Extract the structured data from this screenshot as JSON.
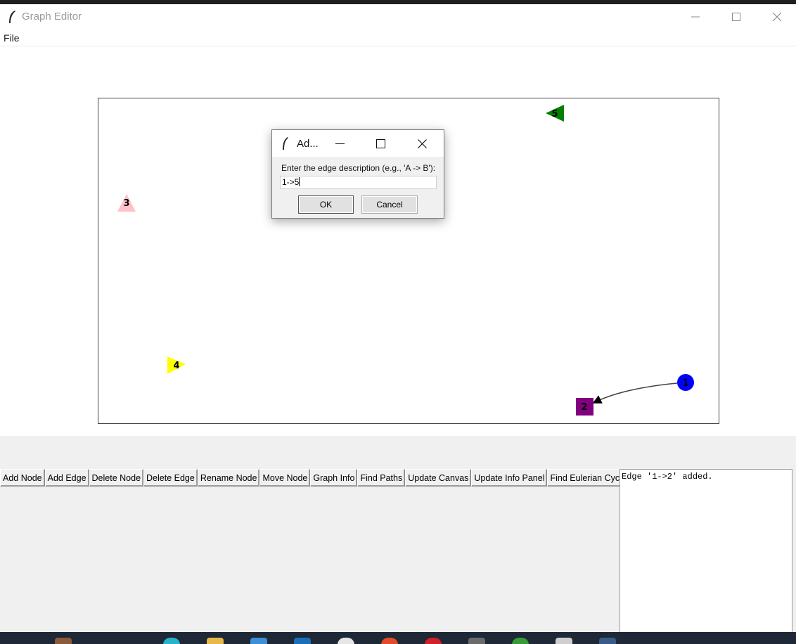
{
  "window": {
    "title": "Graph Editor"
  },
  "menu": {
    "file": "File"
  },
  "graph": {
    "nodes": [
      {
        "label": "1",
        "shape": "circle",
        "color": "#0000ff"
      },
      {
        "label": "2",
        "shape": "square",
        "color": "#800080"
      },
      {
        "label": "3",
        "shape": "triangle-up",
        "color": "#ffc0cb"
      },
      {
        "label": "4",
        "shape": "triangle-right",
        "color": "#ffff00"
      },
      {
        "label": "5",
        "shape": "triangle-left",
        "color": "#008000"
      }
    ],
    "edges": [
      {
        "from": "1",
        "to": "2"
      }
    ]
  },
  "dialog": {
    "title": "Ad...",
    "prompt": "Enter the edge description (e.g., 'A -> B'):",
    "input_value": "1->5",
    "ok": "OK",
    "cancel": "Cancel"
  },
  "toolbar": {
    "buttons": [
      "Add Node",
      "Add Edge",
      "Delete Node",
      "Delete Edge",
      "Rename Node",
      "Move Node",
      "Graph Info",
      "Find Paths",
      "Update Canvas",
      "Update Info Panel",
      "Find Eulerian Cycle"
    ]
  },
  "info_panel": {
    "text": "Edge '1->2' added."
  }
}
